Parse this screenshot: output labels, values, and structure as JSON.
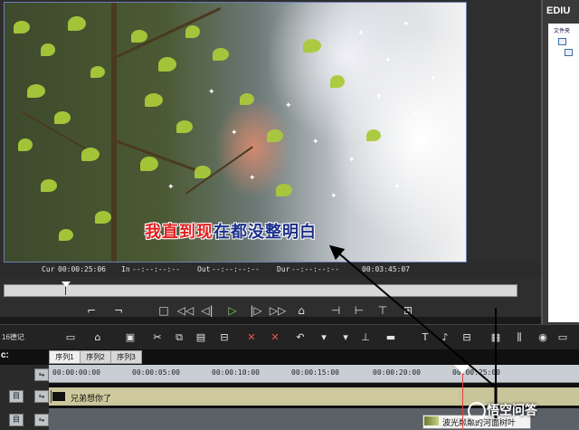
{
  "app": {
    "title": "EDIU"
  },
  "folder_panel": {
    "label": "文件夹"
  },
  "preview": {
    "subtitle_done": "我直到现",
    "subtitle_rest": "在都没整明白"
  },
  "timecode": {
    "cur_label": "Cur",
    "cur_value": "00:00:25:06",
    "in_label": "In",
    "in_value": "--:--:--:--",
    "out_label": "Out",
    "out_value": "--:--:--:--",
    "dur_label": "Dur",
    "dur_value": "--:--:--:--",
    "total_value": "00:03:45:07"
  },
  "toolbar": {
    "project_label": "16德记"
  },
  "timeline": {
    "label": "c:",
    "tabs": [
      "序列1",
      "序列2",
      "序列3"
    ],
    "ruler": [
      "00:00:00:00",
      "00:00:05:00",
      "00:00:10:00",
      "00:00:15:00",
      "00:00:20:00",
      "00:00:25:00"
    ],
    "clips": [
      {
        "label": "兄弟想你了"
      },
      {
        "label": "波光粼粼的河面树叶"
      }
    ]
  },
  "watermark": {
    "text": "悟空问答"
  }
}
